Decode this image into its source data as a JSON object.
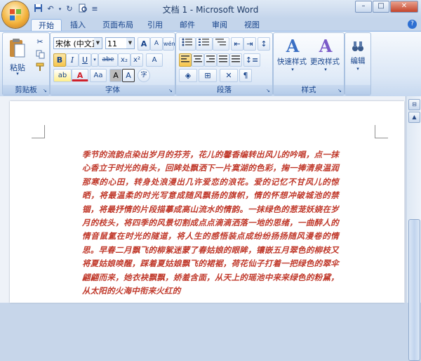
{
  "window": {
    "title": "文档 1 - Microsoft Word"
  },
  "qat": {
    "undo_glyph": "↶",
    "redo_glyph": "↻",
    "more_glyph": "≡"
  },
  "tabs": [
    {
      "label": "开始"
    },
    {
      "label": "插入"
    },
    {
      "label": "页面布局"
    },
    {
      "label": "引用"
    },
    {
      "label": "邮件"
    },
    {
      "label": "审阅"
    },
    {
      "label": "视图"
    }
  ],
  "ribbon": {
    "clipboard": {
      "label": "剪贴板",
      "paste_label": "粘贴"
    },
    "font": {
      "label": "字体",
      "font_name": "宋体 (中文正文)",
      "font_size": "11",
      "grow_glyph": "A",
      "shrink_glyph": "A",
      "wen_glyph": "wén",
      "clear_glyph": "A",
      "bold": "B",
      "italic": "I",
      "underline": "U",
      "strike": "abe",
      "sub": "x₂",
      "sup": "x²",
      "case": "Aa",
      "change_case": "Aa",
      "char_shade": "A",
      "char_border": "A",
      "enclose": "字"
    },
    "paragraph": {
      "label": "段落"
    },
    "styles": {
      "label": "样式",
      "quick_styles": "快速样式",
      "change_styles": "更改样式"
    },
    "editing": {
      "label": "编辑"
    }
  },
  "document": {
    "body": "季节的流韵点染出岁月的芬芳，花儿的馨香编转出风儿的吟唱，点一抹心香立于时光的肩头，回眸处飘洒下一片寞湖的色彩，掬一捧清泉温润那寒的心田，转身处浪漫出几许爱恋的浪花。爱的记忆不甘风儿的惊晒，将最温柔的时光写意成随风飘扬的旗帜，情的怀想冲破城池的禁锢，将最抒情的片段描摹成高山流水的情韵。一抹绿色的葱茏妖娆在岁月的枝头，将四季的风景切割成点点滴滴洒落一地的思绪，一曲醉人的情音鼠氲在时光的隧道，将人生的感悟装点成纷纷扬扬随风漫卷的情思。早春二月飘飞的柳絮迷蒙了春姑娘的眼眸，镶嵌五月翠色的柳枝又将夏姑娘唤醒，踩着夏姑娘飘飞的裙裾，荷花仙子打着一把绿色的翠伞翩翩而来，她衣袂飘飘，娇羞含面，从天上的瑶池中来来绿色的粉黛，从太阳的火海中衔来火红的"
  }
}
